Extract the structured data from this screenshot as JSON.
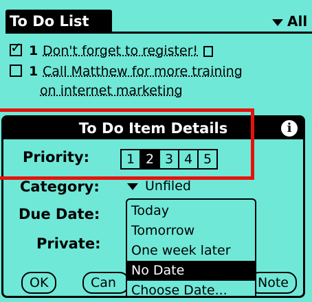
{
  "app": {
    "title": "To Do List",
    "category_filter": "All"
  },
  "todo_items": [
    {
      "checked": true,
      "priority": "1",
      "description": "Don't forget to register!",
      "has_note": true
    },
    {
      "checked": false,
      "priority": "1",
      "description": "Call Matthew for more training",
      "has_note": false
    },
    {
      "checked": false,
      "priority": "",
      "description": "on internet marketing",
      "has_note": false
    }
  ],
  "dialog": {
    "title": "To Do Item Details",
    "info_icon": "info-icon",
    "priority_label": "Priority:",
    "priority_options": [
      "1",
      "2",
      "3",
      "4",
      "5"
    ],
    "priority_selected": "2",
    "category_label": "Category:",
    "category_value": "Unfiled",
    "due_date_label": "Due Date:",
    "private_label": "Private:",
    "buttons": {
      "ok": "OK",
      "cancel": "Can",
      "note": "Note"
    }
  },
  "due_date_popup": {
    "items": [
      "Today",
      "Tomorrow",
      "One week later",
      "No Date",
      "Choose Date..."
    ],
    "selected": "No Date"
  },
  "colors": {
    "background": "#6fe8d8",
    "highlight": "#e8120c"
  }
}
